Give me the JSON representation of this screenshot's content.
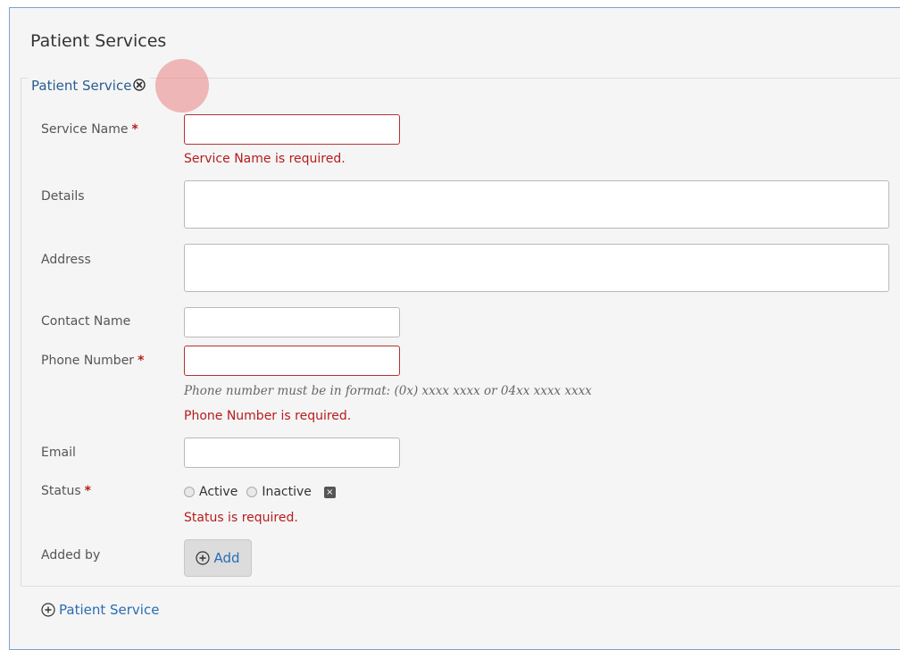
{
  "panel": {
    "title": "Patient Services"
  },
  "fieldset": {
    "legend": "Patient Service"
  },
  "form": {
    "service_name": {
      "label": "Service Name",
      "required_mark": "*",
      "value": "",
      "error": "Service Name is required."
    },
    "details": {
      "label": "Details",
      "value": ""
    },
    "address": {
      "label": "Address",
      "value": ""
    },
    "contact_name": {
      "label": "Contact Name",
      "value": ""
    },
    "phone_number": {
      "label": "Phone Number",
      "required_mark": "*",
      "value": "",
      "hint": "Phone number must be in format: (0x) xxxx xxxx or 04xx xxxx xxxx",
      "error": "Phone Number is required."
    },
    "email": {
      "label": "Email",
      "value": ""
    },
    "status": {
      "label": "Status",
      "required_mark": "*",
      "options": [
        "Active",
        "Inactive"
      ],
      "clear_symbol": "×",
      "error": "Status is required."
    },
    "added_by": {
      "label": "Added by",
      "button_label": "Add"
    }
  },
  "footer": {
    "add_link_label": "Patient Service"
  },
  "colors": {
    "link": "#2a6db3",
    "error": "#b71c1c",
    "legend": "#2a5d8f",
    "highlight": "#e88282"
  }
}
